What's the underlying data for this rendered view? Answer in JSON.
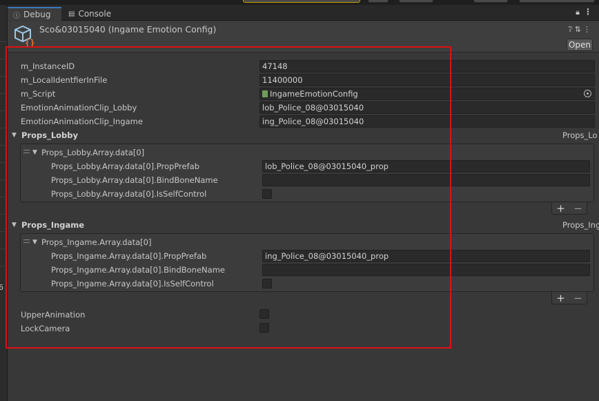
{
  "tabs": [
    {
      "label": "Debug",
      "active": true,
      "icon": "info-icon"
    },
    {
      "label": "Console",
      "active": false,
      "icon": "console-icon"
    }
  ],
  "header": {
    "title": "Sco&03015040 (Ingame Emotion Config)",
    "open_label": "Open"
  },
  "fields": [
    {
      "label": "m_InstanceID",
      "value": "47148"
    },
    {
      "label": "m_LocalIdentfierInFile",
      "value": "11400000"
    },
    {
      "label": "m_Script",
      "value": "IngameEmotionConfig"
    },
    {
      "label": "EmotionAnimationClip_Lobby",
      "value": "lob_Police_08@03015040"
    },
    {
      "label": "EmotionAnimationClip_Ingame",
      "value": "ing_Police_08@03015040"
    }
  ],
  "props_lobby": {
    "label": "Props_Lobby",
    "right_cut": "Props_Lo",
    "element": "Props_Lobby.Array.data[0]",
    "rows": [
      {
        "label": "Props_Lobby.Array.data[0].PropPrefab",
        "value": "lob_Police_08@03015040_prop"
      },
      {
        "label": "Props_Lobby.Array.data[0].BindBoneName",
        "value": ""
      },
      {
        "label": "Props_Lobby.Array.data[0].IsSelfControl"
      }
    ]
  },
  "props_ingame": {
    "label": "Props_Ingame",
    "right_cut": "Props_Ing",
    "element": "Props_Ingame.Array.data[0]",
    "rows": [
      {
        "label": "Props_Ingame.Array.data[0].PropPrefab",
        "value": "ing_Police_08@03015040_prop"
      },
      {
        "label": "Props_Ingame.Array.data[0].BindBoneName",
        "value": ""
      },
      {
        "label": "Props_Ingame.Array.data[0].IsSelfControl"
      }
    ]
  },
  "bottom": [
    {
      "label": "UpperAnimation"
    },
    {
      "label": "LockCamera"
    }
  ],
  "list_buttons": {
    "plus": "+",
    "minus": "−"
  },
  "left_cut_char": "6",
  "colors": {
    "highlight": "#e01010",
    "tab_accent": "#3a79bb",
    "background": "#383838"
  }
}
